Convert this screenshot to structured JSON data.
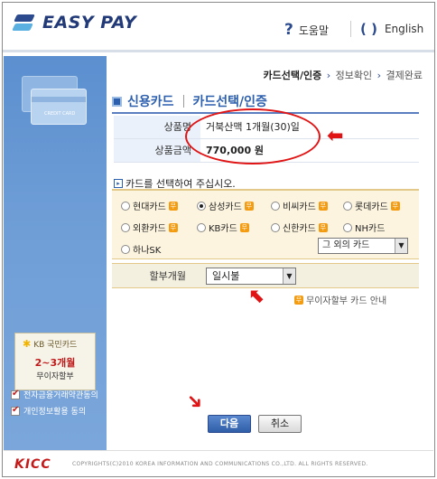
{
  "header": {
    "brand": "EASY PAY",
    "help_label": "도움말",
    "lang_label": "English"
  },
  "sidebar": {
    "card_text": "CREDIT CARD",
    "promo": {
      "bank": "KB 국민카드",
      "line1": "2~3개월",
      "line2": "무이자할부"
    },
    "agreements": [
      {
        "label": "전자금융거래약관동의",
        "checked": true
      },
      {
        "label": "개인정보활용 동의",
        "checked": true
      }
    ]
  },
  "steps": {
    "current": "카드선택/인증",
    "step2": "정보확인",
    "step3": "결제완료"
  },
  "title": {
    "main": "신용카드",
    "sub": "카드선택/인증"
  },
  "product": {
    "name_label": "상품명",
    "name_value": "거북산맥 1개월(30)일",
    "amount_label": "상품금액",
    "amount_value": "770,000 원"
  },
  "card_select": {
    "prompt": "카드를 선택하여 주십시오.",
    "options": [
      {
        "label": "현대카드",
        "selected": false,
        "tag": true
      },
      {
        "label": "삼성카드",
        "selected": true,
        "tag": true
      },
      {
        "label": "비씨카드",
        "selected": false,
        "tag": true
      },
      {
        "label": "롯데카드",
        "selected": false,
        "tag": true
      },
      {
        "label": "외환카드",
        "selected": false,
        "tag": true
      },
      {
        "label": "KB카드",
        "selected": false,
        "tag": true
      },
      {
        "label": "신한카드",
        "selected": false,
        "tag": true
      },
      {
        "label": "NH카드",
        "selected": false,
        "tag": false
      },
      {
        "label": "하나SK",
        "selected": false,
        "tag": false
      }
    ],
    "other_select_value": "그 외의 카드"
  },
  "installment": {
    "label": "할부개월",
    "value": "일시불",
    "no_interest_link": "무이자할부 카드 안내"
  },
  "buttons": {
    "next": "다음",
    "cancel": "취소"
  },
  "footer": {
    "logo": "KICC",
    "copyright": "COPYRIGHTS(C)2010 KOREA INFORMATION AND COMMUNICATIONS CO.,LTD. ALL RIGHTS RESERVED."
  },
  "colors": {
    "accent": "#2c5fae",
    "annotation": "#e01414"
  }
}
